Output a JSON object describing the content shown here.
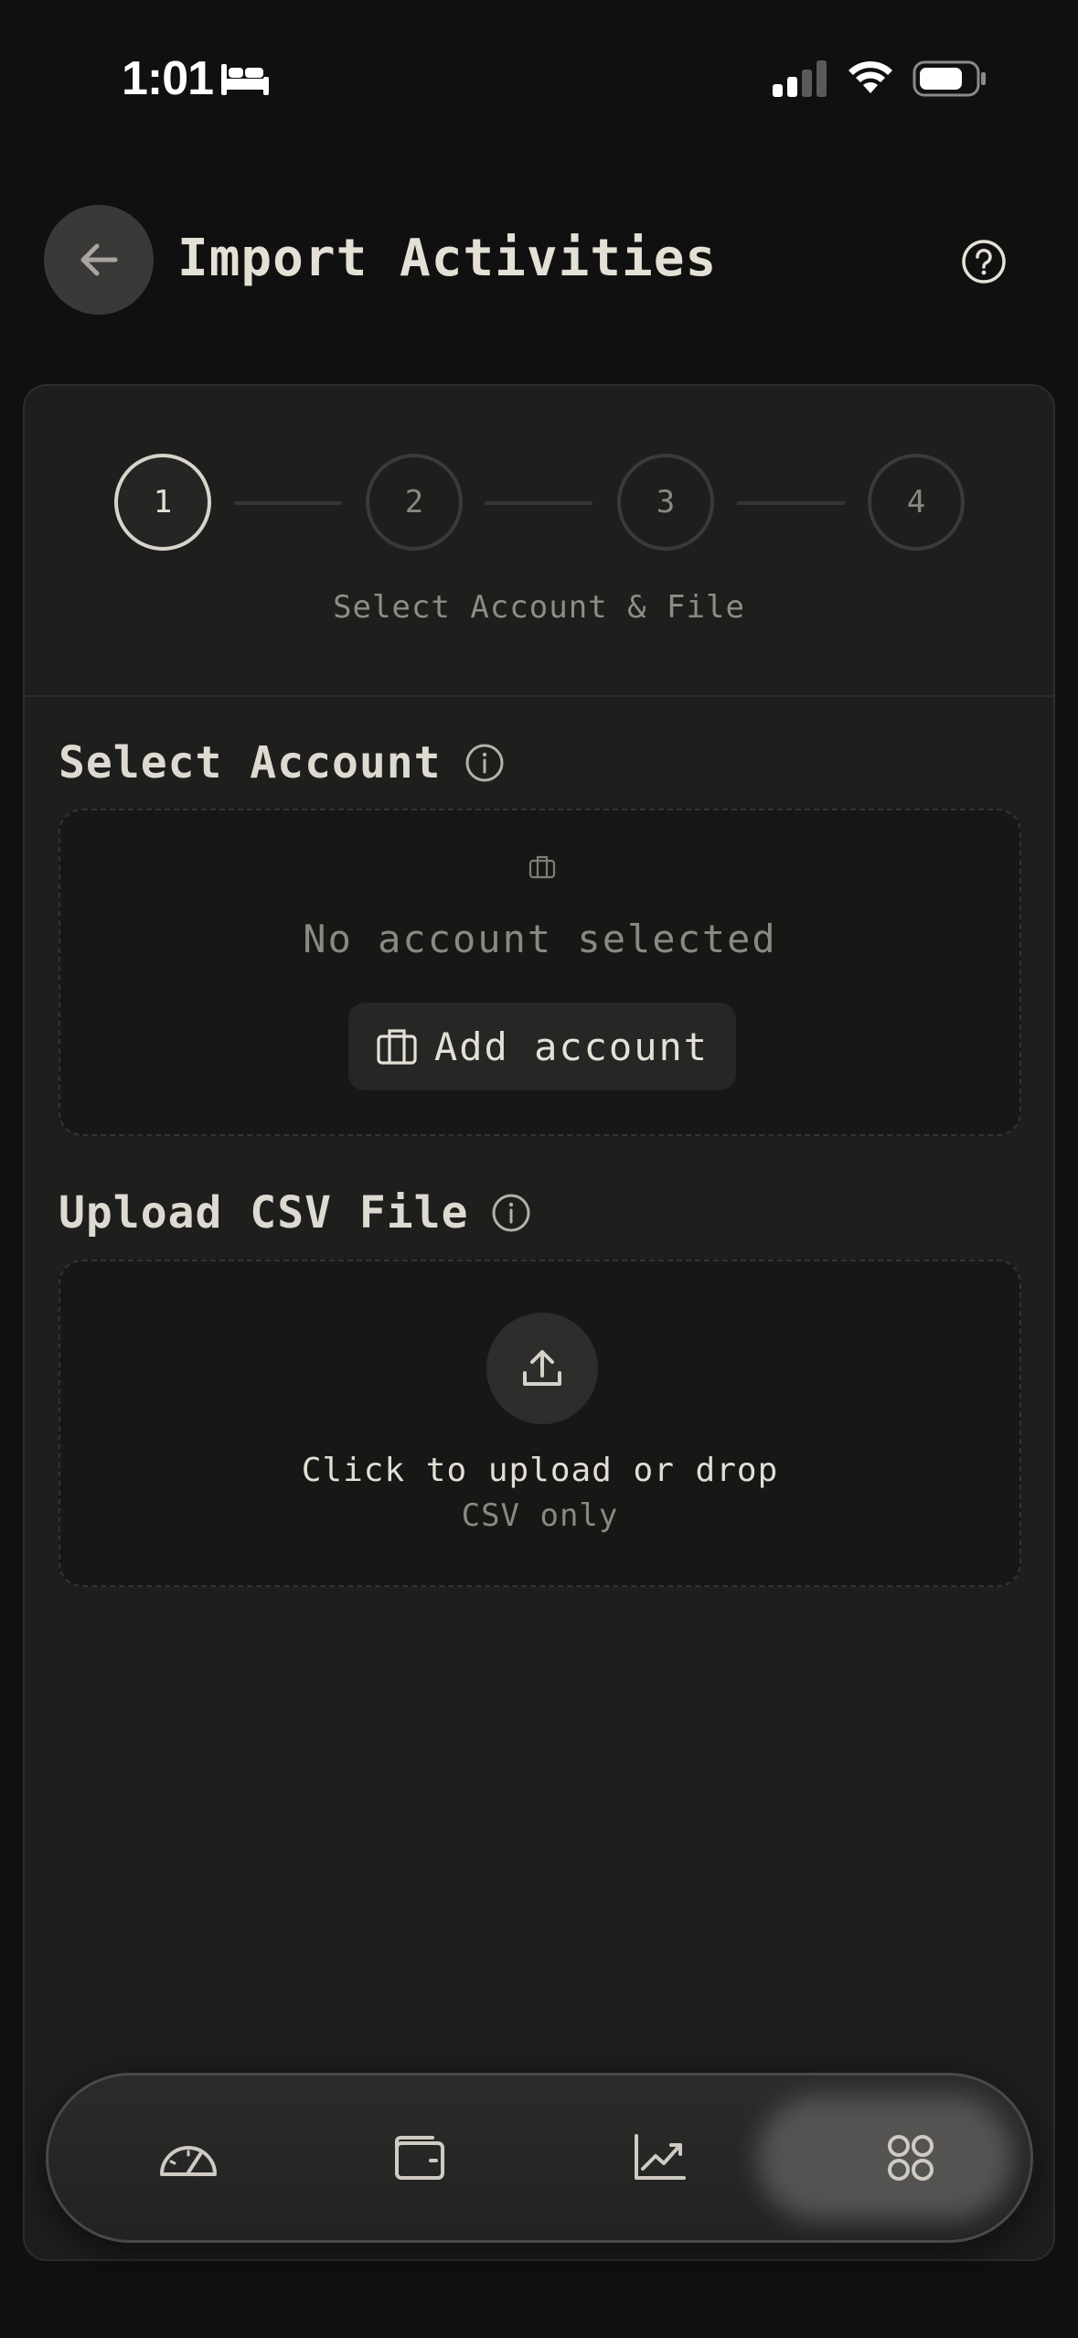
{
  "status_bar": {
    "time": "1:01"
  },
  "header": {
    "title": "Import Activities"
  },
  "stepper": {
    "steps": [
      "1",
      "2",
      "3",
      "4"
    ],
    "active_step": 1,
    "caption": "Select Account & File"
  },
  "account_section": {
    "title": "Select Account",
    "empty_text": "No account selected",
    "add_button_label": "Add account"
  },
  "upload_section": {
    "title": "Upload CSV File",
    "primary_text": "Click to upload or drop",
    "secondary_text": "CSV only"
  },
  "bottom_nav": {
    "items": [
      "dashboard-icon",
      "wallet-icon",
      "chart-icon",
      "apps-grid-icon"
    ],
    "active": "apps-grid-icon"
  },
  "colors": {
    "background": "#101010",
    "card": "#1e1e1d",
    "accent_text": "#e4e0d6",
    "muted_text": "#8b8882"
  }
}
